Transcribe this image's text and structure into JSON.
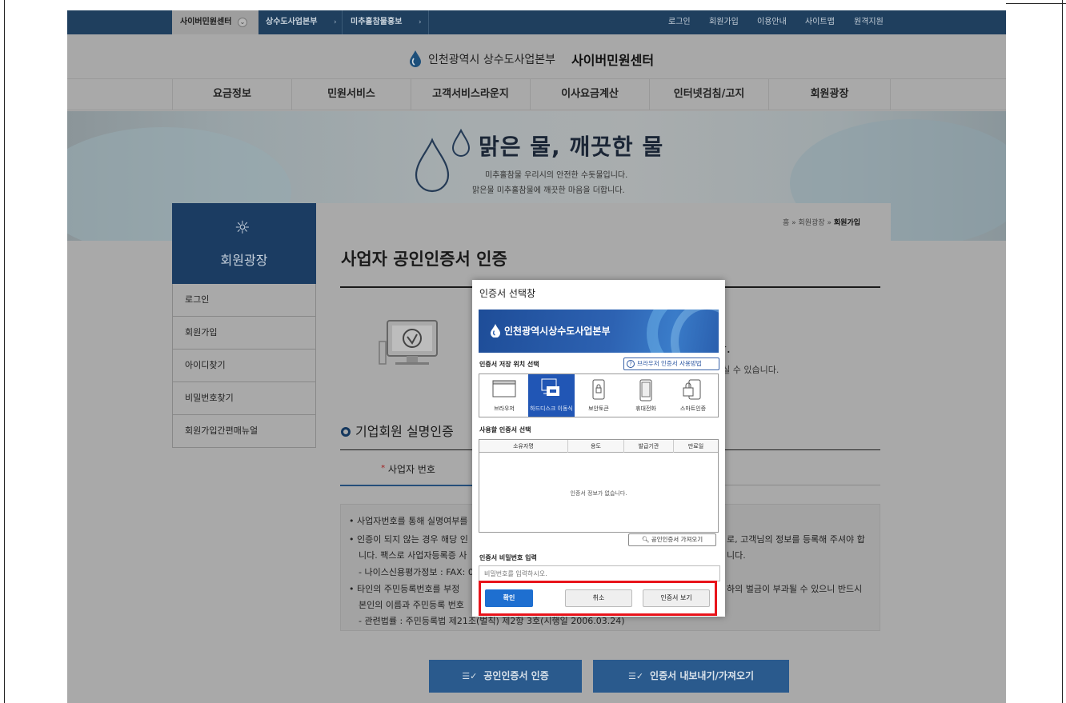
{
  "topbar": {
    "tabs": [
      "사이버민원센터",
      "상수도사업본부",
      "미추홀참물홍보"
    ],
    "right_links": [
      "로그인",
      "회원가입",
      "이용안내",
      "사이트맵",
      "원격지원"
    ]
  },
  "header": {
    "subtitle": "인천광역시 상수도사업본부",
    "title": "사이버민원센터"
  },
  "mainnav": [
    "요금정보",
    "민원서비스",
    "고객서비스라운지",
    "이사요금계산",
    "인터넷검침/고지",
    "회원광장"
  ],
  "hero": {
    "title": "맑은 물, 깨끗한 물",
    "line1": "미추홀참물 우리시의 안전한 수돗물입니다.",
    "line2": "맑은물 미추홀참물에 깨끗한 마음을 더합니다."
  },
  "sidebar": {
    "title": "회원광장",
    "items": [
      "로그인",
      "회원가입",
      "아이디찾기",
      "비밀번호찾기",
      "회원가입간편매뉴얼"
    ]
  },
  "breadcrumb": {
    "home": "홈",
    "section": "회원광장",
    "current": "회원가입"
  },
  "content": {
    "page_title": "사업자 공인인증서 인증",
    "bg_heading_tail": "다.",
    "bg_text_tail": "하실 수 있습니다.",
    "section_title": "기업회원 실명인증",
    "tab_required": "*",
    "tab_label": "사업자 번호"
  },
  "notice": {
    "line1": "• 사업자번호를 통해 실명여부를",
    "line2": "• 인증이 되지 않는 경우 해당 인",
    "line2_tail": "로, 고객님의 정보를 등록해 주셔야 합",
    "line3": "니다. 팩스로 사업자등록증 사",
    "line3_tail": "니다.",
    "line4": "- 나이스신용평가정보 : FAX: 0",
    "line5": "• 타인의 주민등록번호를 부정",
    "line5_tail": "하의 벌금이 부과될 수 있으니 반드시",
    "line6": "본인의 이름과 주민등록 번호",
    "line7": "- 관련법률 : 주민등록법 제21조(벌칙) 제2항 3호(시행일 2006.03.24)"
  },
  "buttons": {
    "cert_auth": "공인인증서 인증",
    "cert_export": "인증서 내보내기/가져오기"
  },
  "dialog": {
    "title": "인증서 선택창",
    "banner": "인천광역시상수도사업본부",
    "storage_label": "인증서 저장 위치 선택",
    "howto": "브라우저 인증서 사용방법",
    "storage_options": [
      "브라우저",
      "하드디스크 이동식",
      "보안토큰",
      "휴대전화",
      "스마트인증"
    ],
    "cert_label": "사용할 인증서 선택",
    "columns": [
      "소유자명",
      "용도",
      "발급기관",
      "만료일"
    ],
    "empty": "인증서 정보가 없습니다.",
    "import": "공인인증서 가져오기",
    "pw_label": "인증서 비밀번호 입력",
    "pw_placeholder": "비밀번호를 입력하시오.",
    "confirm": "확인",
    "cancel": "취소",
    "view": "인증서 보기"
  },
  "colors": {
    "topbar": "#1f3f5e",
    "sidebar_head": "#1b3c62",
    "primary_button": "#1e6fd0",
    "highlight": "#e8141b"
  }
}
